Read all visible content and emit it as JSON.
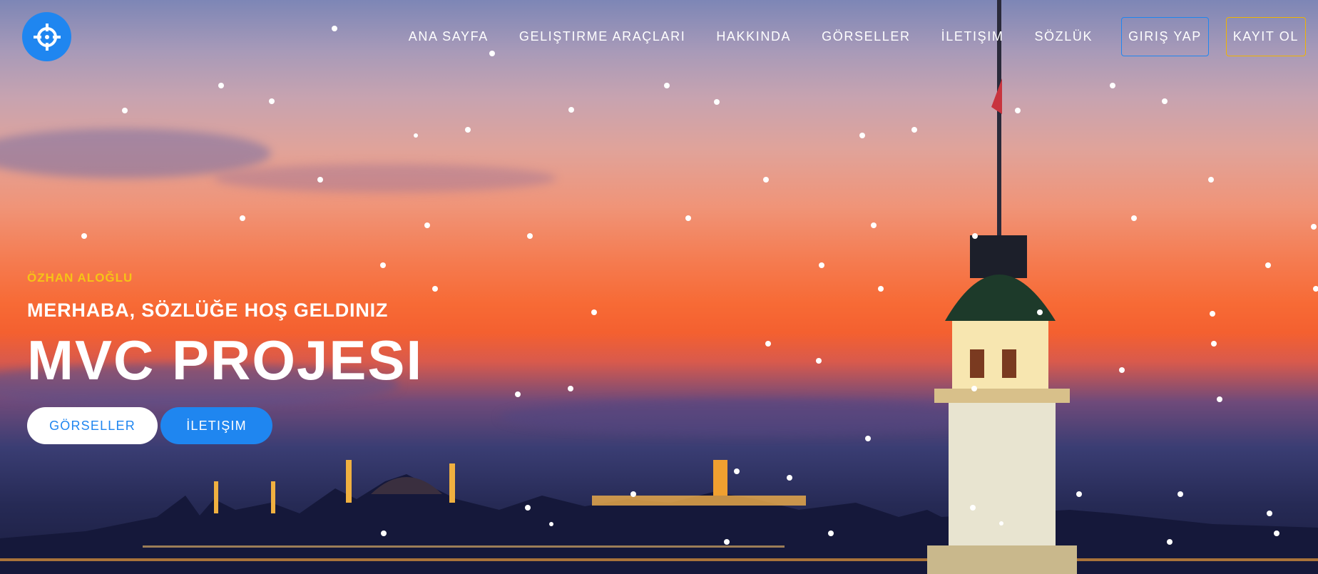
{
  "nav": {
    "items": [
      "ANA SAYFA",
      "GELIŞTIRME ARAÇLARI",
      "HAKKINDA",
      "GÖRSELLER",
      "İLETIŞIM",
      "SÖZLÜK"
    ],
    "login_label": "GIRIŞ YAP",
    "register_label": "KAYIT OL"
  },
  "hero": {
    "author": "ÖZHAN ALOĞLU",
    "greeting": "MERHABA, SÖZLÜĞE HOŞ GELDINIZ",
    "title": "MVC PROJESI",
    "primary_button": "GÖRSELLER",
    "secondary_button": "İLETIŞIM"
  },
  "colors": {
    "accent_blue": "#1f86f0",
    "accent_yellow": "#f6c416",
    "register_border": "#f0b400"
  },
  "icons": {
    "logo": "crosshair-icon"
  }
}
